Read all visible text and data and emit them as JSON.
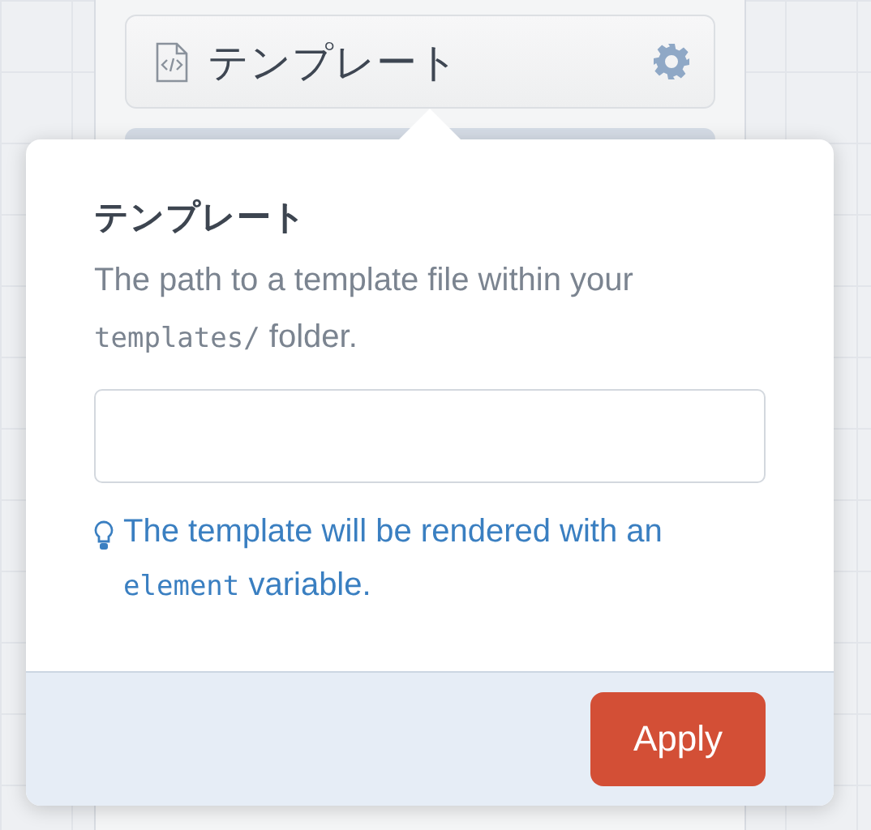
{
  "field_button": {
    "label": "テンプレート"
  },
  "popover": {
    "title": "テンプレート",
    "description": [
      {
        "kind": "text",
        "text": "The path to a template file within your "
      },
      {
        "kind": "code",
        "text": "templates/"
      },
      {
        "kind": "text",
        "text": " folder."
      }
    ],
    "hint": [
      {
        "kind": "text",
        "text": "The template will be rendered with an "
      },
      {
        "kind": "code",
        "text": "element"
      },
      {
        "kind": "text",
        "text": " variable."
      }
    ],
    "buttons": [
      "Apply"
    ]
  }
}
